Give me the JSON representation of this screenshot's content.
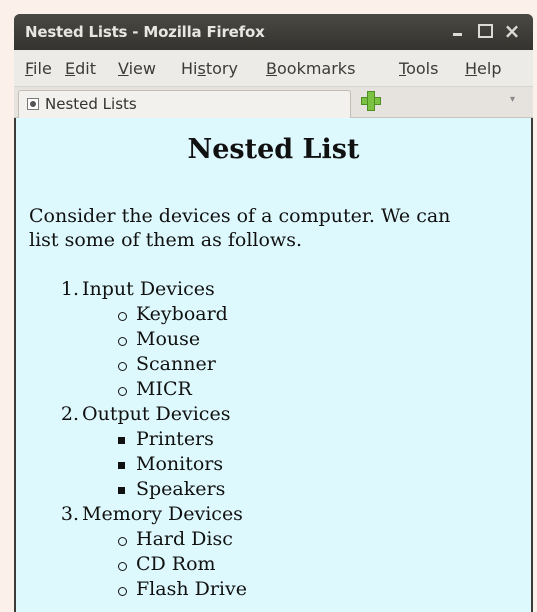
{
  "window": {
    "title": "Nested Lists - Mozilla Firefox",
    "controls": {
      "minimize": "_",
      "maximize": "□",
      "close": "×"
    }
  },
  "menu": [
    {
      "underline": "F",
      "rest": "ile"
    },
    {
      "underline": "E",
      "rest": "dit"
    },
    {
      "underline": "V",
      "rest": "iew"
    },
    {
      "pre": "Hi",
      "underline": "s",
      "rest": "tory"
    },
    {
      "underline": "B",
      "rest": "ookmarks"
    },
    {
      "underline": "T",
      "rest": "ools"
    },
    {
      "underline": "H",
      "rest": "elp"
    }
  ],
  "tab": {
    "label": "Nested Lists",
    "tablist_glyph": "▾"
  },
  "page": {
    "heading": "Nested List",
    "intro_line1": "Consider the devices of a computer. We can",
    "intro_line2": "list some of them as follows.",
    "list": [
      {
        "number": "1.",
        "label": "Input Devices",
        "bullet": "circle",
        "items": [
          "Keyboard",
          "Mouse",
          "Scanner",
          "MICR"
        ]
      },
      {
        "number": "2.",
        "label": "Output Devices",
        "bullet": "square",
        "items": [
          "Printers",
          "Monitors",
          "Speakers"
        ]
      },
      {
        "number": "3.",
        "label": "Memory Devices",
        "bullet": "circle",
        "items": [
          "Hard Disc",
          "CD Rom",
          "Flash Drive"
        ]
      }
    ]
  },
  "colors": {
    "titlebar": "#3c3b37",
    "menubar": "#edebe7",
    "content_bg": "#ddf9fd",
    "page_bg": "#fbf1ea"
  }
}
